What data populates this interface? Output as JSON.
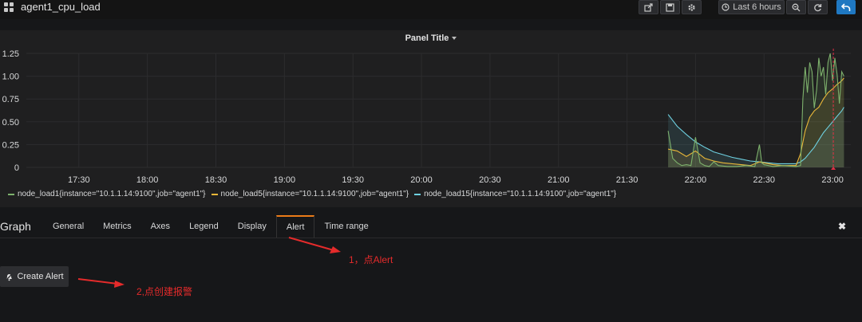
{
  "dashboard": {
    "title": "agent1_cpu_load"
  },
  "toolbar": {
    "share_icon": "share-icon",
    "save_icon": "save-icon",
    "settings_icon": "gear-icon",
    "time_range_label": "Last 6 hours",
    "zoom_icon": "zoom-out-icon",
    "refresh_icon": "refresh-icon",
    "back_icon": "back-arrow-icon"
  },
  "panel": {
    "title": "Panel Title"
  },
  "chart_data": {
    "type": "line",
    "title": "Panel Title",
    "x_ticks": [
      "17:30",
      "18:00",
      "18:30",
      "19:00",
      "19:30",
      "20:00",
      "20:30",
      "21:00",
      "21:30",
      "22:00",
      "22:30",
      "23:00"
    ],
    "y_ticks": [
      "0",
      "0.25",
      "0.50",
      "0.75",
      "1.00",
      "1.25"
    ],
    "ylim": [
      0,
      1.25
    ],
    "xlim": [
      "17:07",
      "23:08"
    ],
    "grid": true,
    "legend_position": "bottom",
    "series": [
      {
        "name": "node_load1{instance=\"10.1.1.14:9100\",job=\"agent1\"}",
        "color": "#7eb26d",
        "x": [
          "21:48",
          "21:50",
          "21:52",
          "21:54",
          "21:56",
          "21:58",
          "22:00",
          "22:02",
          "22:04",
          "22:06",
          "22:08",
          "22:10",
          "22:14",
          "22:18",
          "22:22",
          "22:26",
          "22:28",
          "22:29",
          "22:30",
          "22:34",
          "22:38",
          "22:44",
          "22:46",
          "22:47",
          "22:48",
          "22:49",
          "22:50",
          "22:51",
          "22:52",
          "22:53",
          "22:54",
          "22:55",
          "22:56",
          "22:57",
          "22:58",
          "22:59",
          "23:00",
          "23:01",
          "23:02",
          "23:03",
          "23:04",
          "23:05"
        ],
        "values": [
          0.4,
          0.1,
          0.05,
          0.02,
          0.03,
          0.02,
          0.33,
          0.05,
          0.02,
          0.01,
          0.06,
          0.02,
          0.01,
          0.01,
          0.02,
          0.01,
          0.25,
          0.05,
          0.03,
          0.01,
          0.02,
          0.01,
          0.02,
          0.75,
          1.1,
          0.82,
          1.15,
          1.05,
          0.65,
          0.85,
          1.2,
          1.0,
          1.1,
          0.8,
          1.15,
          1.25,
          0.95,
          1.2,
          1.02,
          0.7,
          1.05,
          1.0
        ]
      },
      {
        "name": "node_load5{instance=\"10.1.1.14:9100\",job=\"agent1\"}",
        "color": "#eab839",
        "x": [
          "21:48",
          "21:52",
          "21:56",
          "22:00",
          "22:02",
          "22:04",
          "22:08",
          "22:12",
          "22:16",
          "22:20",
          "22:24",
          "22:28",
          "22:30",
          "22:34",
          "22:38",
          "22:44",
          "22:46",
          "22:48",
          "22:50",
          "22:52",
          "22:54",
          "22:56",
          "22:58",
          "23:00",
          "23:02",
          "23:04",
          "23:05"
        ],
        "values": [
          0.2,
          0.18,
          0.12,
          0.18,
          0.14,
          0.1,
          0.07,
          0.05,
          0.04,
          0.03,
          0.02,
          0.06,
          0.05,
          0.03,
          0.02,
          0.02,
          0.15,
          0.4,
          0.55,
          0.62,
          0.66,
          0.75,
          0.82,
          0.86,
          0.91,
          0.95,
          0.98
        ]
      },
      {
        "name": "node_load15{instance=\"10.1.1.14:9100\",job=\"agent1\"}",
        "color": "#6ed0e0",
        "x": [
          "21:48",
          "21:52",
          "21:56",
          "22:00",
          "22:04",
          "22:08",
          "22:12",
          "22:16",
          "22:20",
          "22:24",
          "22:28",
          "22:32",
          "22:36",
          "22:40",
          "22:44",
          "22:46",
          "22:48",
          "22:50",
          "22:52",
          "22:54",
          "22:56",
          "22:58",
          "23:00",
          "23:02",
          "23:04",
          "23:05"
        ],
        "values": [
          0.58,
          0.45,
          0.36,
          0.28,
          0.22,
          0.17,
          0.14,
          0.11,
          0.09,
          0.07,
          0.06,
          0.05,
          0.04,
          0.04,
          0.04,
          0.06,
          0.1,
          0.16,
          0.22,
          0.3,
          0.38,
          0.44,
          0.5,
          0.56,
          0.62,
          0.66
        ]
      }
    ],
    "current_time_marker": "23:00"
  },
  "editor": {
    "title": "Graph",
    "tabs": [
      "General",
      "Metrics",
      "Axes",
      "Legend",
      "Display",
      "Alert",
      "Time range"
    ],
    "active_tab": "Alert",
    "close_icon": "close-icon",
    "create_alert_label": "Create Alert",
    "create_alert_icon": "bell-icon"
  },
  "annotations": {
    "step1": "1，点Alert",
    "step2": "2,点创建报警",
    "color": "#e52b2b"
  },
  "colors": {
    "background": "#161719",
    "panel": "#1f1f20",
    "accent": "#eb7b18",
    "primary": "#1f78c1"
  }
}
